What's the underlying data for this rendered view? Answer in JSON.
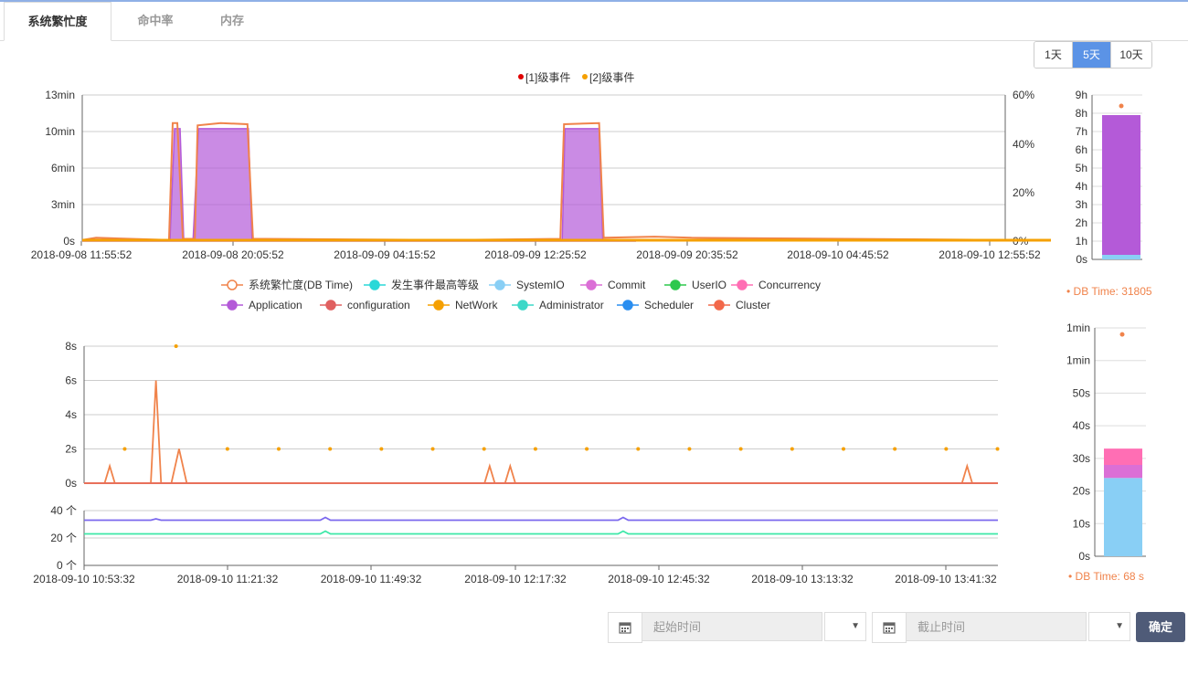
{
  "tabs": [
    {
      "label": "系统繁忙度"
    },
    {
      "label": "命中率"
    },
    {
      "label": "内存"
    }
  ],
  "range_buttons": [
    {
      "label": "1天"
    },
    {
      "label": "5天"
    },
    {
      "label": "10天"
    }
  ],
  "top_legend": [
    {
      "label": "[1]级事件",
      "color": "#e00000"
    },
    {
      "label": "[2]级事件",
      "color": "#f5a000"
    }
  ],
  "series_legend": [
    {
      "label": "系统繁忙度(DB Time)",
      "color": "#f0834b",
      "hollow": true
    },
    {
      "label": "发生事件最高等级",
      "color": "#2ad8d8"
    },
    {
      "label": "SystemIO",
      "color": "#89cff5"
    },
    {
      "label": "Commit",
      "color": "#db6fd6"
    },
    {
      "label": "UserIO",
      "color": "#2dc84d"
    },
    {
      "label": "Concurrency",
      "color": "#ff6eb4"
    },
    {
      "label": "Application",
      "color": "#b45ad8"
    },
    {
      "label": "configuration",
      "color": "#e06060"
    },
    {
      "label": "NetWork",
      "color": "#f5a000"
    },
    {
      "label": "Administrator",
      "color": "#3dd8c8"
    },
    {
      "label": "Scheduler",
      "color": "#2a8ef0"
    },
    {
      "label": "Cluster",
      "color": "#f2684a"
    }
  ],
  "right_panel": {
    "top_db_time": "• DB Time: 31805",
    "bottom_db_time": "• DB Time: 68 s"
  },
  "filters": {
    "start_placeholder": "起始时间",
    "end_placeholder": "截止时间",
    "confirm_label": "确定"
  },
  "chart_data": [
    {
      "id": "top-chart",
      "type": "area",
      "x_ticks": [
        "2018-09-08 11:55:52",
        "2018-09-08 20:05:52",
        "2018-09-09 04:15:52",
        "2018-09-09 12:25:52",
        "2018-09-09 20:35:52",
        "2018-09-10 04:45:52",
        "2018-09-10 12:55:52"
      ],
      "y_left_ticks": [
        "0s",
        "3min",
        "6min",
        "10min",
        "13min"
      ],
      "y_right_ticks": [
        "0%",
        "20%",
        "40%",
        "60%"
      ],
      "y_left_range_min": [
        0,
        13
      ],
      "x_range": [
        0,
        60
      ],
      "series": [
        {
          "name": "Application",
          "color": "#b45ad8",
          "fill": true,
          "points": [
            [
              0,
              0
            ],
            [
              9.5,
              0
            ],
            [
              10,
              10
            ],
            [
              10.6,
              10
            ],
            [
              11,
              0
            ],
            [
              12,
              0
            ],
            [
              12.6,
              10
            ],
            [
              18,
              10
            ],
            [
              18.4,
              0
            ],
            [
              52,
              0
            ],
            [
              52.3,
              10
            ],
            [
              56,
              10
            ],
            [
              56.4,
              0
            ],
            [
              60,
              0
            ]
          ]
        },
        {
          "name": "系统繁忙度(DB Time)",
          "color": "#f0834b",
          "points": [
            [
              0,
              0.1
            ],
            [
              1.5,
              0.3
            ],
            [
              9.4,
              0.1
            ],
            [
              9.8,
              10.5
            ],
            [
              10.3,
              10.5
            ],
            [
              10.9,
              0.2
            ],
            [
              12.2,
              0.2
            ],
            [
              12.5,
              10.3
            ],
            [
              15,
              10.5
            ],
            [
              17.9,
              10.4
            ],
            [
              18.5,
              0.2
            ],
            [
              19.8,
              0.2
            ],
            [
              40,
              0.1
            ],
            [
              51.8,
              0.2
            ],
            [
              52.2,
              10.4
            ],
            [
              56,
              10.5
            ],
            [
              56.5,
              0.3
            ],
            [
              62,
              0.4
            ],
            [
              66,
              0.3
            ],
            [
              100,
              0.1
            ]
          ]
        },
        {
          "name": "[2]级事件",
          "color": "#f5a000",
          "points": [
            [
              0,
              0
            ],
            [
              100,
              0
            ]
          ]
        }
      ]
    },
    {
      "id": "top-right-bar",
      "type": "bar",
      "y_ticks": [
        "0s",
        "1h",
        "2h",
        "3h",
        "4h",
        "5h",
        "6h",
        "7h",
        "8h",
        "9h"
      ],
      "y_range_hours": [
        0,
        9
      ],
      "stack": [
        {
          "name": "SystemIO",
          "value": 0.25,
          "color": "#89cff5"
        },
        {
          "name": "Application",
          "value": 7.65,
          "color": "#b45ad8"
        }
      ],
      "db_time_marker": 8.4
    },
    {
      "id": "bottom-chart",
      "type": "line",
      "x_ticks": [
        "2018-09-10 10:53:32",
        "2018-09-10 11:21:32",
        "2018-09-10 11:49:32",
        "2018-09-10 12:17:32",
        "2018-09-10 12:45:32",
        "2018-09-10 13:13:32",
        "2018-09-10 13:41:32"
      ],
      "y_upper_ticks": [
        "0s",
        "2s",
        "4s",
        "6s",
        "8s"
      ],
      "y_upper_range": [
        0,
        8
      ],
      "y_lower_ticks": [
        "0 个",
        "20 个",
        "40 个"
      ],
      "y_lower_range": [
        0,
        40
      ],
      "x_range_minutes": [
        0,
        178
      ],
      "db_time_series": {
        "name": "系统繁忙度(DB Time)",
        "color": "#f0834b",
        "points": [
          [
            0,
            0
          ],
          [
            4,
            0
          ],
          [
            5,
            1
          ],
          [
            6,
            0
          ],
          [
            13,
            0
          ],
          [
            14,
            6
          ],
          [
            15,
            0
          ],
          [
            17,
            0
          ],
          [
            18.5,
            2
          ],
          [
            20,
            0
          ],
          [
            78,
            0
          ],
          [
            79,
            1
          ],
          [
            80,
            0
          ],
          [
            82,
            0
          ],
          [
            83,
            1
          ],
          [
            84,
            0
          ],
          [
            171,
            0
          ],
          [
            172,
            1
          ],
          [
            173,
            0
          ],
          [
            178,
            0
          ]
        ]
      },
      "event_dots": {
        "name": "[2]级事件",
        "color": "#f5a000",
        "points": [
          [
            4,
            2
          ],
          [
            14,
            8
          ],
          [
            24,
            2
          ],
          [
            34,
            2
          ],
          [
            44,
            2
          ],
          [
            54,
            2
          ],
          [
            64,
            2
          ],
          [
            74,
            2
          ],
          [
            84,
            2
          ],
          [
            94,
            2
          ],
          [
            104,
            2
          ],
          [
            114,
            2
          ],
          [
            124,
            2
          ],
          [
            134,
            2
          ],
          [
            144,
            2
          ],
          [
            154,
            2
          ],
          [
            164,
            2
          ],
          [
            174,
            2
          ]
        ]
      },
      "count_series": [
        {
          "name": "Scheduler",
          "color": "#7b68ee",
          "points": [
            [
              0,
              33
            ],
            [
              13,
              33
            ],
            [
              14,
              34
            ],
            [
              15,
              33
            ],
            [
              46,
              33
            ],
            [
              47,
              35
            ],
            [
              48,
              33
            ],
            [
              104,
              33
            ],
            [
              105,
              35
            ],
            [
              106,
              33
            ],
            [
              178,
              33
            ]
          ]
        },
        {
          "name": "Administrator",
          "color": "#3de8a8",
          "points": [
            [
              0,
              23
            ],
            [
              46,
              23
            ],
            [
              47,
              25
            ],
            [
              48,
              23
            ],
            [
              104,
              23
            ],
            [
              105,
              25
            ],
            [
              106,
              23
            ],
            [
              178,
              23
            ]
          ]
        }
      ]
    },
    {
      "id": "bottom-right-bar",
      "type": "bar",
      "y_ticks": [
        "0s",
        "10s",
        "20s",
        "30s",
        "40s",
        "50s",
        "1min",
        "1min"
      ],
      "y_range_seconds": [
        0,
        70
      ],
      "stack": [
        {
          "name": "SystemIO",
          "value": 24,
          "color": "#89cff5"
        },
        {
          "name": "Commit",
          "value": 4,
          "color": "#db6fd6"
        },
        {
          "name": "Concurrency",
          "value": 5,
          "color": "#ff6eb4"
        }
      ],
      "db_time_marker": 68
    }
  ]
}
